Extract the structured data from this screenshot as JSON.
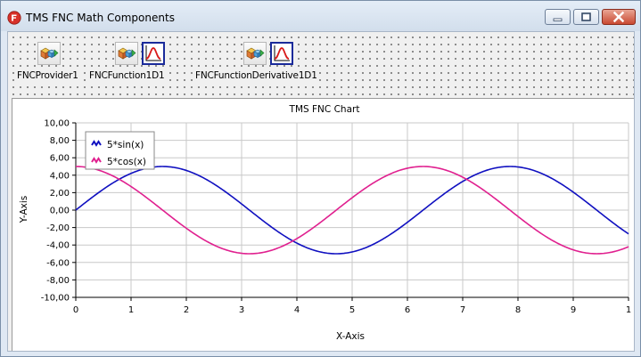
{
  "window": {
    "title": "TMS FNC Math Components",
    "buttons": [
      "minimize",
      "maximize",
      "close"
    ]
  },
  "components": [
    {
      "label": "FNCProvider1",
      "icon": "provider-icon"
    },
    {
      "label": "FNCFunction1D1",
      "icon": "function-icon"
    },
    {
      "label": "FNCFunctionDerivative1D1",
      "icon": "function-derivative-icon"
    }
  ],
  "colors": {
    "series_sin": "#1010c0",
    "series_cos": "#e0208f",
    "grid": "#c8c8c8",
    "design_grid_dot": "#4d4d4d"
  },
  "chart_data": {
    "type": "line",
    "title": "TMS FNC Chart",
    "xlabel": "X-Axis",
    "ylabel": "Y-Axis",
    "xlim": [
      0,
      10
    ],
    "ylim": [
      -10,
      10
    ],
    "x_ticks": [
      "0",
      "1",
      "2",
      "3",
      "4",
      "5",
      "6",
      "7",
      "8",
      "9",
      "1"
    ],
    "y_ticks": [
      "10,00",
      "8,00",
      "6,00",
      "4,00",
      "2,00",
      "0,00",
      "-2,00",
      "-4,00",
      "-6,00",
      "-8,00",
      "-10,00"
    ],
    "grid": true,
    "legend_position": "top-left",
    "series": [
      {
        "name": "5*sin(x)",
        "function": "sin",
        "amplitude": 5,
        "color": "#1010c0",
        "x": [
          0,
          0.5,
          1,
          1.5,
          2,
          2.5,
          3,
          3.5,
          4,
          4.5,
          5,
          5.5,
          6,
          6.5,
          7,
          7.5,
          8,
          8.5,
          9,
          9.5,
          10
        ],
        "values": [
          0,
          2.4,
          4.21,
          4.99,
          4.55,
          2.99,
          0.71,
          -1.75,
          -3.78,
          -4.89,
          -4.79,
          -3.53,
          -1.4,
          1.08,
          3.28,
          4.69,
          4.95,
          3.99,
          2.06,
          -0.38,
          -2.72
        ]
      },
      {
        "name": "5*cos(x)",
        "function": "cos",
        "amplitude": 5,
        "color": "#e0208f",
        "x": [
          0,
          0.5,
          1,
          1.5,
          2,
          2.5,
          3,
          3.5,
          4,
          4.5,
          5,
          5.5,
          6,
          6.5,
          7,
          7.5,
          8,
          8.5,
          9,
          9.5,
          10
        ],
        "values": [
          5,
          4.39,
          2.7,
          0.35,
          -2.08,
          -4.01,
          -4.95,
          -4.68,
          -3.27,
          -1.05,
          1.42,
          3.54,
          4.8,
          4.88,
          3.77,
          1.73,
          -0.73,
          -3.01,
          -4.56,
          -4.99,
          -4.2
        ]
      }
    ]
  }
}
